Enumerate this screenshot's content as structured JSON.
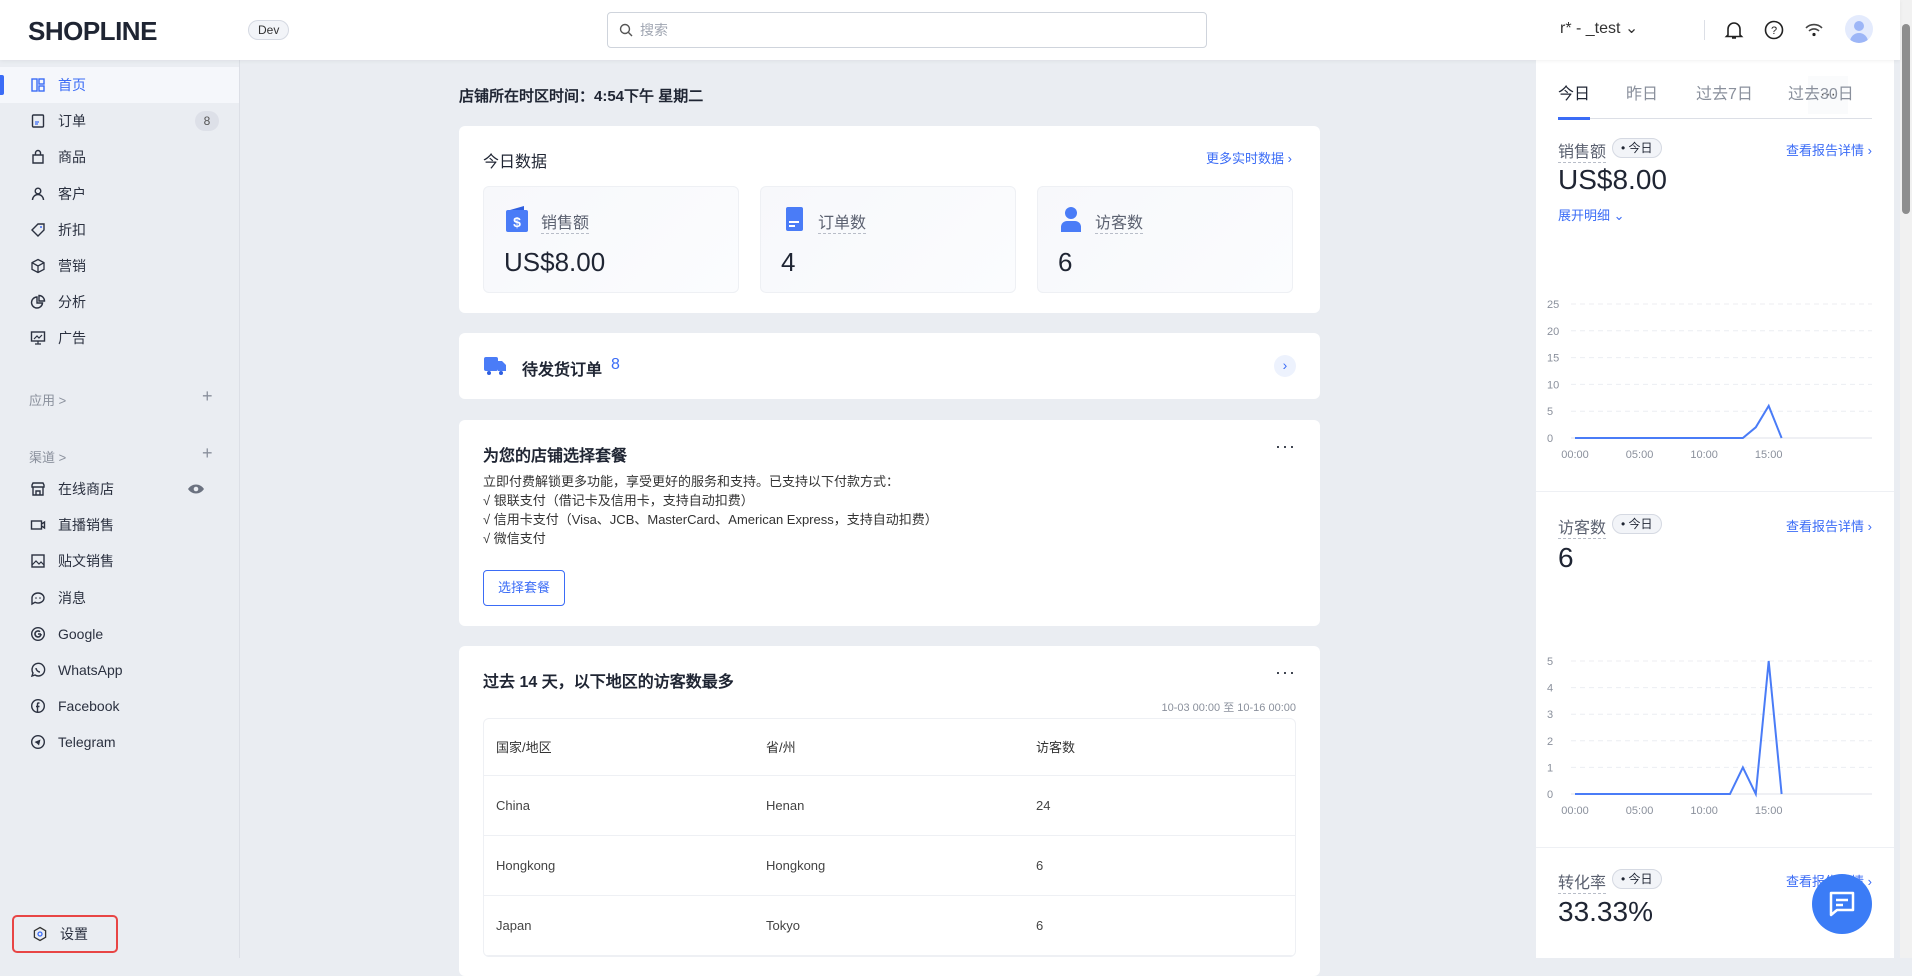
{
  "header": {
    "logo": "SHOPLINE",
    "env_badge": "Dev",
    "search_placeholder": "搜索",
    "store_name": "r*    -  _test"
  },
  "sidebar": {
    "items": [
      {
        "label": "首页",
        "icon": "dashboard-icon",
        "active": true
      },
      {
        "label": "订单",
        "icon": "order-icon",
        "badge": "8"
      },
      {
        "label": "商品",
        "icon": "bag-icon"
      },
      {
        "label": "客户",
        "icon": "user-icon"
      },
      {
        "label": "折扣",
        "icon": "tag-icon"
      },
      {
        "label": "营销",
        "icon": "cube-icon"
      },
      {
        "label": "分析",
        "icon": "pie-chart-icon"
      },
      {
        "label": "广告",
        "icon": "ad-monitor-icon"
      }
    ],
    "apps_label": "应用 >",
    "channels_label": "渠道 >",
    "channels": [
      {
        "label": "在线商店",
        "icon": "store-icon"
      },
      {
        "label": "直播销售",
        "icon": "video-icon"
      },
      {
        "label": "贴文销售",
        "icon": "image-icon"
      },
      {
        "label": "消息",
        "icon": "chat-icon"
      },
      {
        "label": "Google",
        "icon": "google-icon"
      },
      {
        "label": "WhatsApp",
        "icon": "whatsapp-icon"
      },
      {
        "label": "Facebook",
        "icon": "facebook-icon"
      },
      {
        "label": "Telegram",
        "icon": "telegram-icon"
      }
    ],
    "settings_label": "设置"
  },
  "main": {
    "store_time": "店铺所在时区时间：4:54下午 星期二",
    "today": {
      "title": "今日数据",
      "more_link": "更多实时数据 ›",
      "stats": [
        {
          "label": "销售额",
          "value": "US$8.00"
        },
        {
          "label": "订单数",
          "value": "4"
        },
        {
          "label": "访客数",
          "value": "6"
        }
      ]
    },
    "pending": {
      "label": "待发货订单",
      "count": "8"
    },
    "plan": {
      "title": "为您的店铺选择套餐",
      "desc": "立即付费解锁更多功能，享受更好的服务和支持。已支持以下付款方式：",
      "lines": [
        "√ 银联支付（借记卡及信用卡，支持自动扣费）",
        "√ 信用卡支付（Visa、JCB、MasterCard、American Express，支持自动扣费）",
        "√ 微信支付"
      ],
      "button": "选择套餐"
    },
    "regions": {
      "title": "过去 14 天，以下地区的访客数最多",
      "range": "10-03 00:00 至 10-16 00:00",
      "columns": [
        "国家/地区",
        "省/州",
        "访客数"
      ],
      "rows": [
        [
          "China",
          "Henan",
          "24"
        ],
        [
          "Hongkong",
          "Hongkong",
          "6"
        ],
        [
          "Japan",
          "Tokyo",
          "6"
        ]
      ]
    }
  },
  "right": {
    "tabs": [
      "今日",
      "昨日",
      "过去7日",
      "过去30日"
    ],
    "active_tab": "今日",
    "more": "···",
    "metrics": [
      {
        "label": "销售额",
        "pill": "• 今日",
        "value": "US$8.00",
        "link": "查看报告详情 ›",
        "expand": "展开明细"
      },
      {
        "label": "访客数",
        "pill": "• 今日",
        "value": "6",
        "link": "查看报告详情 ›"
      },
      {
        "label": "转化率",
        "pill": "• 今日",
        "value": "33.33%",
        "link": "查看报告详情 ›"
      }
    ]
  },
  "chart_data": [
    {
      "type": "line",
      "title": "销售额",
      "x": [
        "00:00",
        "01:00",
        "02:00",
        "03:00",
        "04:00",
        "05:00",
        "06:00",
        "07:00",
        "08:00",
        "09:00",
        "10:00",
        "11:00",
        "12:00",
        "13:00",
        "14:00",
        "15:00",
        "16:00"
      ],
      "values": [
        0,
        0,
        0,
        0,
        0,
        0,
        0,
        0,
        0,
        0,
        0,
        0,
        0,
        0,
        2,
        6,
        0
      ],
      "xticks": [
        "00:00",
        "05:00",
        "10:00",
        "15:00"
      ],
      "yticks": [
        0,
        5,
        10,
        15,
        20,
        25
      ],
      "ylim": [
        0,
        25
      ],
      "grid": true,
      "color": "#4a7cf7"
    },
    {
      "type": "line",
      "title": "访客数",
      "x": [
        "00:00",
        "01:00",
        "02:00",
        "03:00",
        "04:00",
        "05:00",
        "06:00",
        "07:00",
        "08:00",
        "09:00",
        "10:00",
        "11:00",
        "12:00",
        "13:00",
        "14:00",
        "15:00",
        "16:00"
      ],
      "values": [
        0,
        0,
        0,
        0,
        0,
        0,
        0,
        0,
        0,
        0,
        0,
        0,
        0,
        1,
        0,
        5,
        0
      ],
      "xticks": [
        "00:00",
        "05:00",
        "10:00",
        "15:00"
      ],
      "yticks": [
        0,
        1,
        2,
        3,
        4,
        5
      ],
      "ylim": [
        0,
        5
      ],
      "grid": true,
      "color": "#4a7cf7"
    }
  ],
  "colors": {
    "accent": "#3b6cf6",
    "highlight_box": "#e84545"
  }
}
